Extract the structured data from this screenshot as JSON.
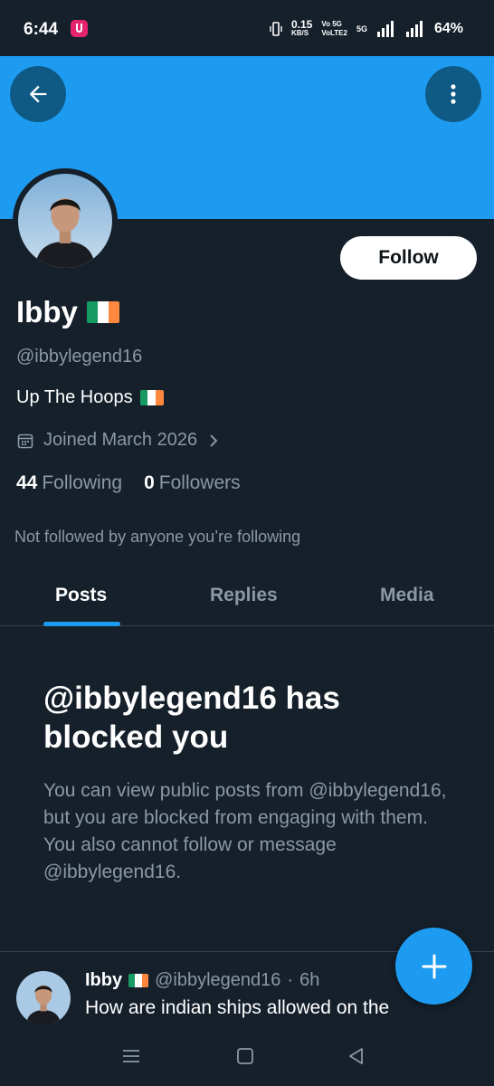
{
  "status_bar": {
    "time": "6:44",
    "speed_value": "0.15",
    "speed_unit": "KB/S",
    "volte_top": "Vo 5G",
    "volte_bottom": "VoLTE2",
    "network": "5G",
    "battery": "64%"
  },
  "profile": {
    "name": "Ibby",
    "handle": "@ibbylegend16",
    "bio": "Up The Hoops",
    "joined": "Joined March 2026",
    "following_count": "44",
    "following_label": "Following",
    "followers_count": "0",
    "followers_label": "Followers",
    "mutuals_note": "Not followed by anyone you’re following",
    "follow_button": "Follow"
  },
  "tabs": [
    {
      "label": "Posts",
      "active": true
    },
    {
      "label": "Replies",
      "active": false
    },
    {
      "label": "Media",
      "active": false
    }
  ],
  "blocked": {
    "title": "@ibbylegend16 has blocked you",
    "description": "You can view public posts from @ibbylegend16, but you are blocked from engaging with them. You also cannot follow or message @ibbylegend16."
  },
  "post": {
    "name": "Ibby",
    "handle": "@ibbylegend16",
    "separator": "·",
    "time": "6h",
    "text": "How are indian ships allowed on the"
  },
  "colors": {
    "background": "#15202b",
    "banner": "#1d9bf0",
    "accent": "#1d9bf0",
    "secondary_text": "#8b98a5"
  },
  "icons": {
    "back": "arrow-left-icon",
    "more": "more-vertical-icon",
    "calendar": "calendar-icon",
    "chevron": "chevron-right-icon",
    "compose": "plus-icon",
    "flag": "ireland-flag-icon"
  }
}
